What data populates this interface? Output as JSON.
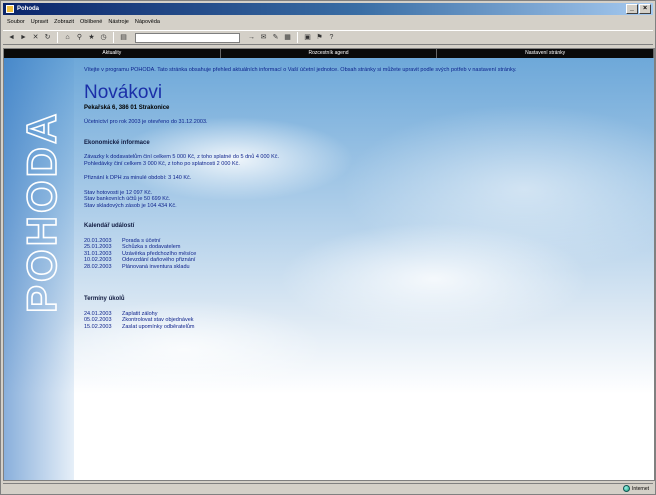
{
  "window": {
    "title": "Pohoda"
  },
  "menu": [
    "Soubor",
    "Upravit",
    "Zobrazit",
    "Oblíbené",
    "Nástroje",
    "Nápověda"
  ],
  "nav": [
    "Aktuality",
    "Rozcestník agend",
    "Nastavení stránky"
  ],
  "logo": "POHODA",
  "content": {
    "intro": "Vítejte v programu POHODA. Tato stránka obsahuje přehled aktuálních informací o Vaší účetní jednotce. Obsah stránky si můžete upravit podle svých potřeb v nastavení stránky.",
    "family_name": "Novákovi",
    "address": "Pekařská 6, 386 01 Strakonice",
    "period_note": "Účetnictví pro rok 2003 je otevřeno do 31.12.2003.",
    "economic_heading": "Ekonomické informace",
    "economic_lines": [
      "Závazky k dodavatelům činí celkem 5 000 Kč, z toho splatné do 5 dnů 4 000 Kč.",
      "Pohledávky činí celkem 3 000 Kč, z toho po splatnosti 2 000 Kč."
    ],
    "vat_line": "Přiznání k DPH za minulé období: 3 140 Kč.",
    "balance_lines": [
      "Stav hotovosti je 12 097 Kč.",
      "Stav bankovních účtů je 50 699 Kč.",
      "Stav skladových zásob je 104 434 Kč."
    ],
    "calendar_heading": "Kalendář událostí",
    "calendar": [
      {
        "date": "20.01.2003",
        "text": "Porada s účetní"
      },
      {
        "date": "25.01.2003",
        "text": "Schůzka s dodavatelem"
      },
      {
        "date": "31.01.2003",
        "text": "Uzávěrka předchozího měsíce"
      },
      {
        "date": "10.02.2003",
        "text": "Odevzdání daňového přiznání"
      },
      {
        "date": "28.02.2003",
        "text": "Plánovaná inventura skladu"
      }
    ],
    "tasks_heading": "Termíny úkolů",
    "tasks": [
      {
        "date": "24.01.2003",
        "text": "Zaplatit zálohy"
      },
      {
        "date": "05.02.2003",
        "text": "Zkontrolovat stav objednávek"
      },
      {
        "date": "15.02.2003",
        "text": "Zaslat upomínky odběratelům"
      }
    ]
  },
  "status": {
    "zone": "Internet"
  }
}
